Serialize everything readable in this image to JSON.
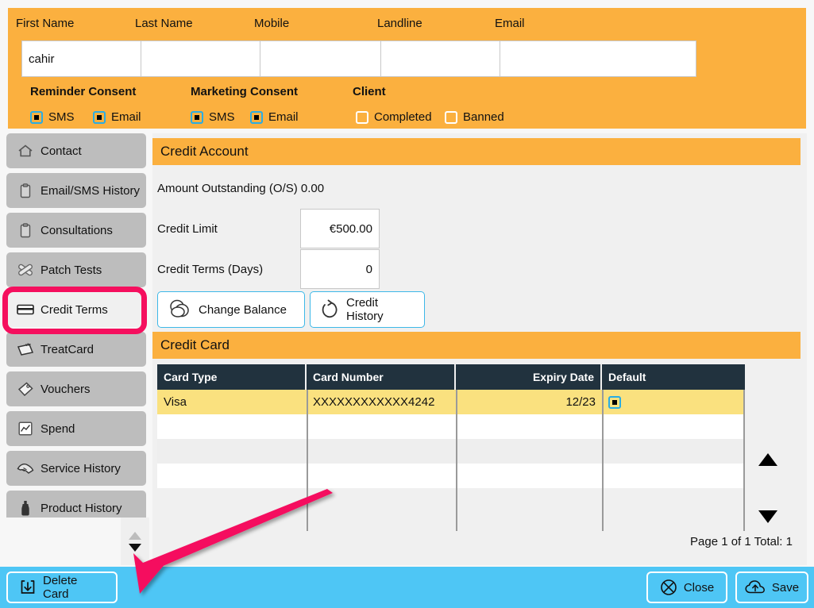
{
  "contact_header": {
    "fields": [
      {
        "label": "First Name",
        "value": "cahir",
        "placeholder": ""
      },
      {
        "label": "Last Name",
        "value": "",
        "placeholder": ""
      },
      {
        "label": "Mobile",
        "value": "",
        "placeholder": ""
      },
      {
        "label": "Landline",
        "value": "",
        "placeholder": ""
      },
      {
        "label": "Email",
        "value": "",
        "placeholder": ""
      }
    ],
    "groups": [
      {
        "title": "Reminder Consent"
      },
      {
        "title": "Marketing Consent"
      },
      {
        "title": "Client"
      }
    ],
    "reminder_consent": [
      {
        "label": "SMS",
        "checked": true
      },
      {
        "label": "Email",
        "checked": true
      }
    ],
    "marketing_consent": [
      {
        "label": "SMS",
        "checked": true
      },
      {
        "label": "Email",
        "checked": true
      }
    ],
    "client": [
      {
        "label": "Completed",
        "checked": false
      },
      {
        "label": "Banned",
        "checked": false
      }
    ]
  },
  "sidebar": {
    "items": [
      {
        "label": "Contact",
        "icon": "home-icon",
        "active": false
      },
      {
        "label": "Email/SMS History",
        "icon": "clipboard-icon",
        "active": false
      },
      {
        "label": "Consultations",
        "icon": "clipboard-icon",
        "active": false
      },
      {
        "label": "Patch Tests",
        "icon": "bandage-icon",
        "active": false
      },
      {
        "label": "Credit Terms",
        "icon": "credit-card-icon",
        "active": true
      },
      {
        "label": "TreatCard",
        "icon": "treatcard-icon",
        "active": false
      },
      {
        "label": "Vouchers",
        "icon": "tag-icon",
        "active": false
      },
      {
        "label": "Spend",
        "icon": "chart-icon",
        "active": false
      },
      {
        "label": "Service History",
        "icon": "hands-icon",
        "active": false
      },
      {
        "label": "Product History",
        "icon": "bottle-icon",
        "active": false
      }
    ]
  },
  "credit_account": {
    "section_title": "Credit Account",
    "amount_outstanding": "Amount Outstanding (O/S) 0.00",
    "credit_limit_label": "Credit Limit",
    "credit_limit_value": "€500.00",
    "credit_terms_label": "Credit Terms (Days)",
    "credit_terms_value": "0",
    "change_balance_label": "Change Balance",
    "credit_history_label": "Credit History"
  },
  "credit_card": {
    "section_title": "Credit Card",
    "columns": [
      "Card Type",
      "Card Number",
      "Expiry Date",
      "Default"
    ],
    "rows": [
      {
        "card_type": "Visa",
        "card_number": "XXXXXXXXXXXX4242",
        "expiry_date": "12/23",
        "default": true,
        "selected": true
      },
      {
        "card_type": "",
        "card_number": "",
        "expiry_date": "",
        "default": false,
        "selected": false
      },
      {
        "card_type": "",
        "card_number": "",
        "expiry_date": "",
        "default": false,
        "selected": false
      },
      {
        "card_type": "",
        "card_number": "",
        "expiry_date": "",
        "default": false,
        "selected": false
      }
    ],
    "page_info": "Page 1 of 1  Total: 1"
  },
  "bottom_bar": {
    "delete_card_label": "Delete Card",
    "close_label": "Close",
    "save_label": "Save"
  },
  "colors": {
    "orange": "#fbb03f",
    "cyan_bar": "#4ec6f5",
    "table_header": "#21323e",
    "row_selected": "#fae17f",
    "annotation_pink": "#f50f5e",
    "sidebar_item": "#bdbdbd",
    "content_bg": "#f0f0f0",
    "accent_border": "#3db8e8"
  }
}
